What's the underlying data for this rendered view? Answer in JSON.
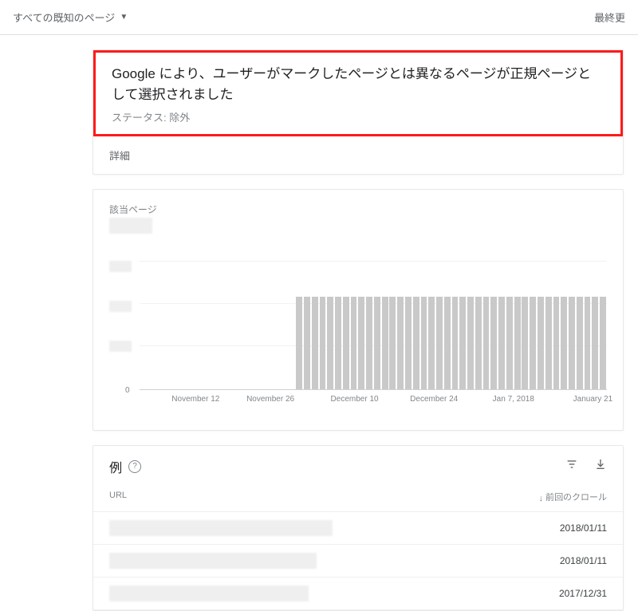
{
  "topbar": {
    "dropdown_label": "すべての既知のページ",
    "right_label": "最終更"
  },
  "header": {
    "title_prefix": "Google",
    "title_rest": " により、ユーザーがマークしたページとは異なるページが正規ページとして選択されました",
    "subtitle": "ステータス: 除外",
    "detail_label": "詳細"
  },
  "chart": {
    "section_label": "該当ページ",
    "zero_label": "0",
    "xticks": [
      "November 12",
      "November 26",
      "December 10",
      "December 24",
      "Jan 7, 2018",
      "January 21"
    ]
  },
  "chart_data": {
    "type": "bar",
    "title": "該当ページ",
    "xlabel": "",
    "ylabel": "",
    "categories_start": "2017-11-05",
    "categories_end": "2018-01-27",
    "categories_approx_count": 84,
    "series": [
      {
        "name": "pages",
        "values_approx": "0 for roughly the first 28 days, then a constant non-zero value (redacted magnitude) thereafter"
      }
    ],
    "xticks": [
      "November 12",
      "November 26",
      "December 10",
      "December 24",
      "Jan 7, 2018",
      "January 21"
    ],
    "ylim_label_visible": [
      "0"
    ],
    "note": "Y-axis scale values are redacted/blurred in source image; only the 0 baseline label is visible."
  },
  "examples": {
    "title": "例",
    "col_url": "URL",
    "col_date": "前回のクロール",
    "rows": [
      {
        "url_redacted_width": 280,
        "date": "2018/01/11"
      },
      {
        "url_redacted_width": 260,
        "date": "2018/01/11"
      },
      {
        "url_redacted_width": 250,
        "date": "2017/12/31"
      }
    ]
  }
}
